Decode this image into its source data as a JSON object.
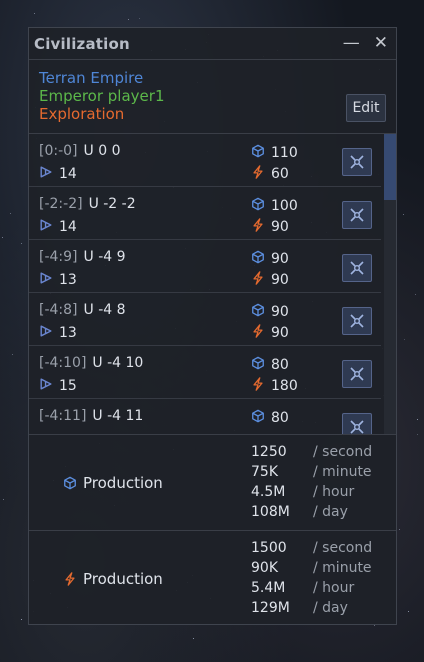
{
  "window": {
    "title": "Civilization",
    "minimize_glyph": "—",
    "close_glyph": "✕"
  },
  "header": {
    "empire": "Terran Empire",
    "rank": "Emperor player1",
    "focus": "Exploration",
    "edit_label": "Edit",
    "colors": {
      "empire": "#4f86d6",
      "rank": "#5cb84a",
      "focus": "#e56a2f"
    }
  },
  "icons": {
    "cube": "cube-icon",
    "bolt": "bolt-icon",
    "speed": "fast-forward-icon",
    "action": "target-icon"
  },
  "accent_colors": {
    "cube": "#5c8fe0",
    "bolt": "#e56a2f",
    "speed": "#6a86d0"
  },
  "systems": [
    {
      "coords": "[0:-0]",
      "name": "U 0 0",
      "speed": "14",
      "cube": "110",
      "bolt": "60"
    },
    {
      "coords": "[-2:-2]",
      "name": "U -2 -2",
      "speed": "14",
      "cube": "100",
      "bolt": "90"
    },
    {
      "coords": "[-4:9]",
      "name": "U -4 9",
      "speed": "13",
      "cube": "90",
      "bolt": "90"
    },
    {
      "coords": "[-4:8]",
      "name": "U -4 8",
      "speed": "13",
      "cube": "90",
      "bolt": "90"
    },
    {
      "coords": "[-4:10]",
      "name": "U -4 10",
      "speed": "15",
      "cube": "80",
      "bolt": "180"
    },
    {
      "coords": "[-4:11]",
      "name": "U -4 11",
      "speed": "",
      "cube": "80",
      "bolt": ""
    }
  ],
  "scroll": {
    "position_fraction": 0.0
  },
  "production": [
    {
      "label": "Production",
      "icon": "cube-icon",
      "rows": [
        {
          "value": "1250",
          "unit": "/ second"
        },
        {
          "value": "75K",
          "unit": "/ minute"
        },
        {
          "value": "4.5M",
          "unit": "/ hour"
        },
        {
          "value": "108M",
          "unit": "/ day"
        }
      ]
    },
    {
      "label": "Production",
      "icon": "bolt-icon",
      "rows": [
        {
          "value": "1500",
          "unit": "/ second"
        },
        {
          "value": "90K",
          "unit": "/ minute"
        },
        {
          "value": "5.4M",
          "unit": "/ hour"
        },
        {
          "value": "129M",
          "unit": "/ day"
        }
      ]
    }
  ]
}
